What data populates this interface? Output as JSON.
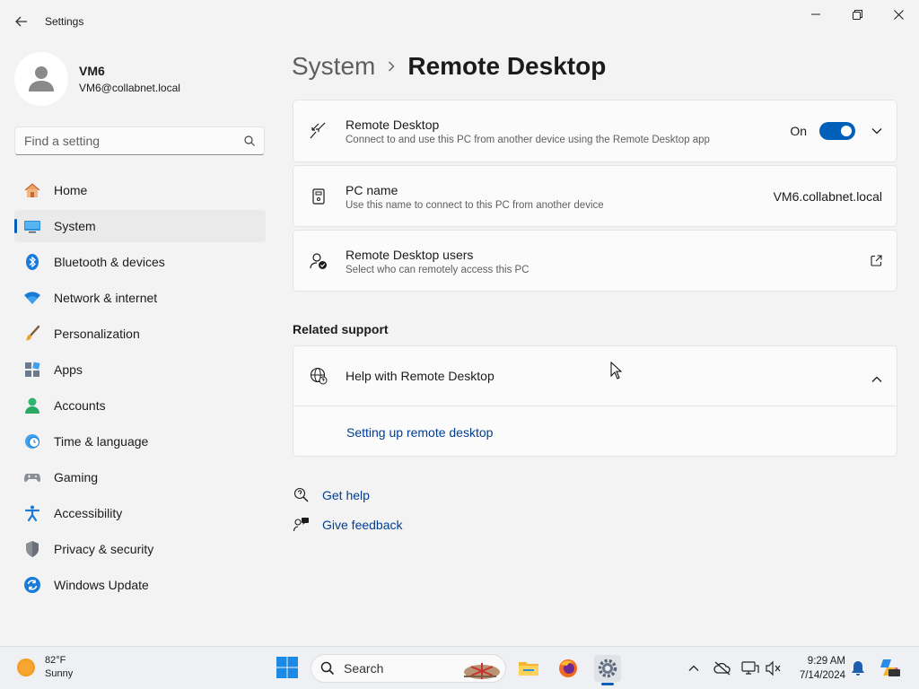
{
  "window": {
    "title": "Settings"
  },
  "profile": {
    "name": "VM6",
    "email": "VM6@collabnet.local"
  },
  "search": {
    "placeholder": "Find a setting"
  },
  "nav": [
    {
      "label": "Home",
      "icon": "home-icon"
    },
    {
      "label": "System",
      "icon": "system-icon",
      "selected": true
    },
    {
      "label": "Bluetooth & devices",
      "icon": "bluetooth-icon"
    },
    {
      "label": "Network & internet",
      "icon": "wifi-icon"
    },
    {
      "label": "Personalization",
      "icon": "brush-icon"
    },
    {
      "label": "Apps",
      "icon": "apps-icon"
    },
    {
      "label": "Accounts",
      "icon": "accounts-icon"
    },
    {
      "label": "Time & language",
      "icon": "clock-globe-icon"
    },
    {
      "label": "Gaming",
      "icon": "gamepad-icon"
    },
    {
      "label": "Accessibility",
      "icon": "accessibility-icon"
    },
    {
      "label": "Privacy & security",
      "icon": "shield-icon"
    },
    {
      "label": "Windows Update",
      "icon": "update-icon"
    }
  ],
  "breadcrumb": {
    "parent": "System",
    "current": "Remote Desktop"
  },
  "remote_desktop": {
    "title": "Remote Desktop",
    "subtitle": "Connect to and use this PC from another device using the Remote Desktop app",
    "state_label": "On",
    "enabled": true
  },
  "pc_name": {
    "title": "PC name",
    "subtitle": "Use this name to connect to this PC from another device",
    "value": "VM6.collabnet.local"
  },
  "rd_users": {
    "title": "Remote Desktop users",
    "subtitle": "Select who can remotely access this PC"
  },
  "related": {
    "heading": "Related support",
    "help_title": "Help with Remote Desktop",
    "help_link": "Setting up remote desktop"
  },
  "footer_links": {
    "get_help": "Get help",
    "give_feedback": "Give feedback"
  },
  "taskbar": {
    "weather": {
      "temp": "82°F",
      "condition": "Sunny"
    },
    "search_label": "Search",
    "time": "9:29 AM",
    "date": "7/14/2024"
  },
  "colors": {
    "accent": "#005fb8",
    "link": "#003e92"
  }
}
